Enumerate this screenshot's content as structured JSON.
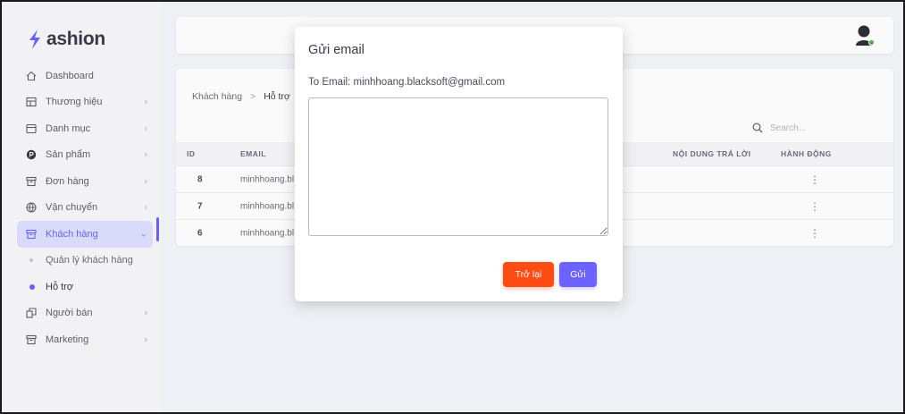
{
  "brand": {
    "name": "ashion",
    "accent": "#6c63ff"
  },
  "sidebar": {
    "items": [
      {
        "label": "Dashboard",
        "icon": "home-icon"
      },
      {
        "label": "Thương hiệu",
        "icon": "grid-icon"
      },
      {
        "label": "Danh mục",
        "icon": "calendar-icon"
      },
      {
        "label": "Sản phẩm",
        "icon": "product-circle-icon"
      },
      {
        "label": "Đơn hàng",
        "icon": "archive-icon"
      },
      {
        "label": "Vận chuyển",
        "icon": "globe-icon"
      },
      {
        "label": "Khách hàng",
        "icon": "archive-icon"
      }
    ],
    "sub_items": [
      {
        "label": "Quản lý khách hàng"
      },
      {
        "label": "Hỗ trợ"
      }
    ],
    "items_after": [
      {
        "label": "Người bán",
        "icon": "copy-icon"
      },
      {
        "label": "Marketing",
        "icon": "archive-icon"
      }
    ]
  },
  "breadcrumb": {
    "parent": "Khách hàng",
    "separator": ">",
    "current": "Hỗ trợ"
  },
  "search": {
    "placeholder": "Search..."
  },
  "table": {
    "columns": [
      "ID",
      "EMAIL",
      "NỘI DUNG TRẢ LỜI",
      "HÀNH ĐỘNG"
    ],
    "rows": [
      {
        "id": "8",
        "email": "minhhoang.bl",
        "action": "⋮"
      },
      {
        "id": "7",
        "email": "minhhoang.bl",
        "action": "⋮"
      },
      {
        "id": "6",
        "email": "minhhoang.bl",
        "action": "⋮"
      }
    ]
  },
  "modal": {
    "title": "Gửi email",
    "to_line": "To Email: minhhoang.blacksoft@gmail.com",
    "textarea_value": "",
    "back_label": "Trở lại",
    "send_label": "Gửi"
  }
}
